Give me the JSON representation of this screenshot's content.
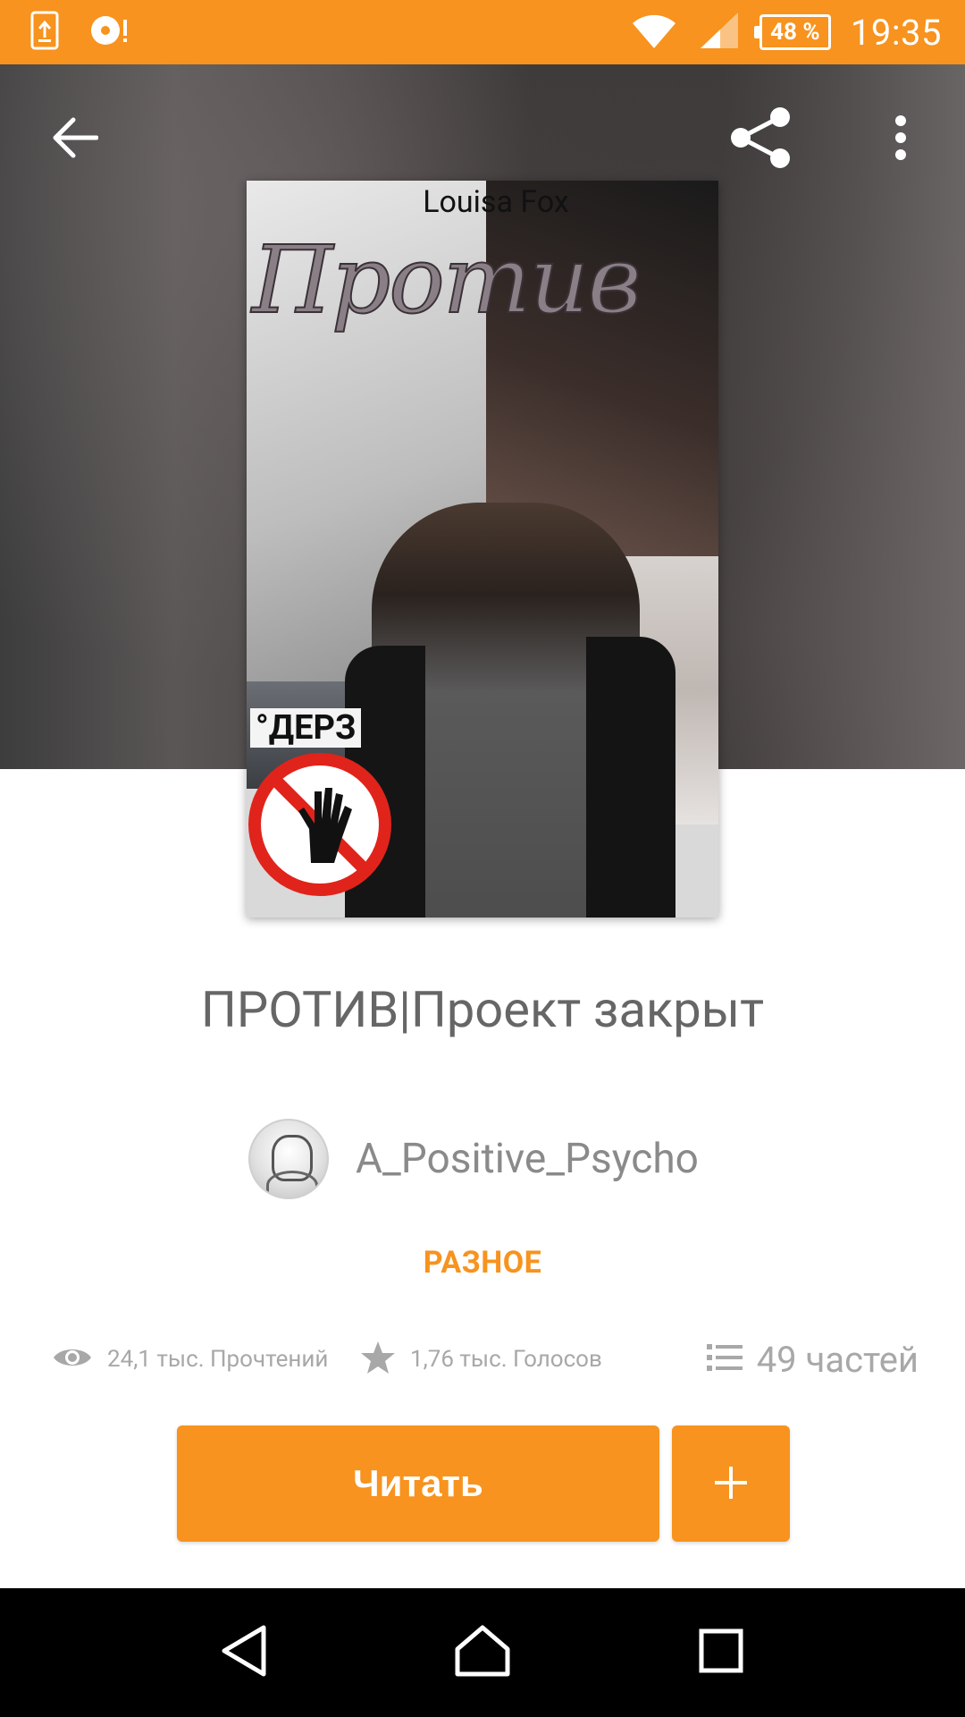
{
  "status_bar": {
    "battery": "48 %",
    "time": "19:35",
    "colors": {
      "background": "#f7931e"
    }
  },
  "toolbar": {
    "back_icon": "arrow-left-icon",
    "share_icon": "share-icon",
    "overflow_icon": "more-vertical-icon"
  },
  "cover": {
    "author_text": "Louisa Fox",
    "title_text": "Против",
    "sign_text": "°ДЕРЗ"
  },
  "book": {
    "title": "ПРОТИВ|Проект закрыт",
    "author": "A_Positive_Psycho",
    "category": "РАЗНОЕ"
  },
  "stats": {
    "reads": "24,1 тыс. Прочтений",
    "votes": "1,76 тыс. Голосов",
    "parts": "49 частей",
    "icons": [
      "eye-icon",
      "star-icon",
      "list-icon"
    ]
  },
  "actions": {
    "read_label": "Читать",
    "add_label": "+"
  },
  "colors": {
    "accent": "#f7931e",
    "title_text": "#666666",
    "muted_text": "#a8a8a8"
  }
}
